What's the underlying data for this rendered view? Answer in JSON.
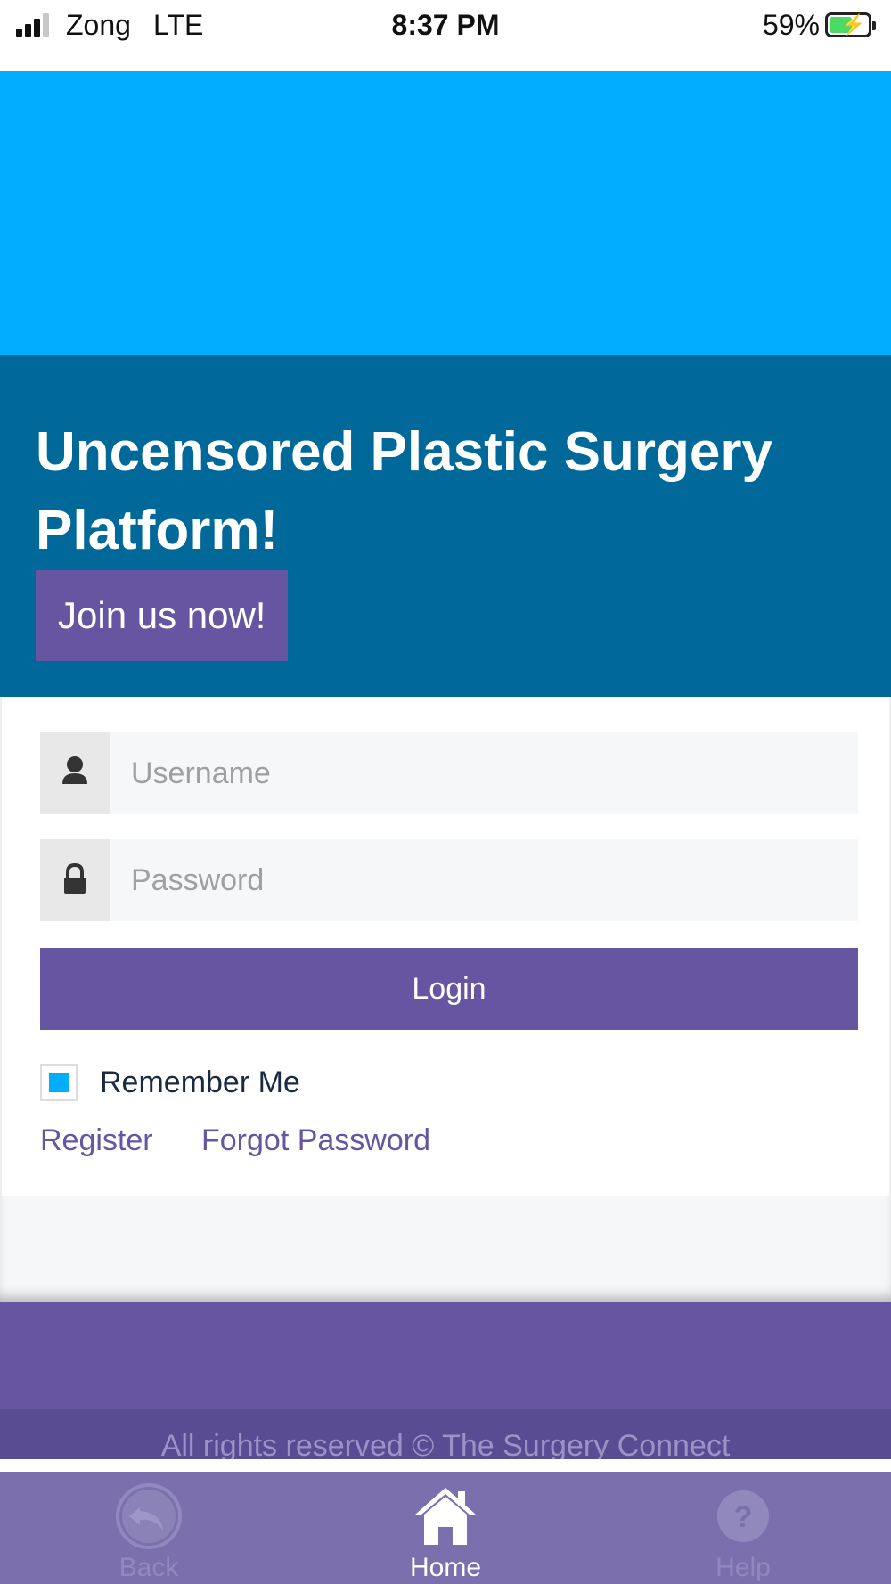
{
  "status_bar": {
    "carrier": "Zong",
    "network": "LTE",
    "time": "8:37 PM",
    "battery_percent": "59%",
    "battery_level": 0.59,
    "signal_bars": 3,
    "icons": [
      "signal-icon",
      "battery-charging-icon"
    ]
  },
  "hero": {
    "title": "Uncensored Plastic Surgery Platform!",
    "join_label": "Join us now!"
  },
  "login_form": {
    "username_placeholder": "Username",
    "password_placeholder": "Password",
    "login_label": "Login",
    "remember_label": "Remember Me",
    "remember_checked": true,
    "register_label": "Register",
    "forgot_label": "Forgot Password",
    "icons": [
      "user-icon",
      "lock-icon"
    ]
  },
  "footer": {
    "copyright": "All rights reserved © The Surgery Connect"
  },
  "bottom_nav": {
    "items": [
      {
        "label": "Back",
        "icon": "back-arrow-icon",
        "active": false
      },
      {
        "label": "Home",
        "icon": "home-icon",
        "active": true
      },
      {
        "label": "Help",
        "icon": "help-icon",
        "active": false
      }
    ]
  },
  "colors": {
    "hero_top": "#00adff",
    "hero": "#006999",
    "accent": "#6655a0",
    "checkbox": "#00adff",
    "nav_bar": "#7b70ad"
  }
}
